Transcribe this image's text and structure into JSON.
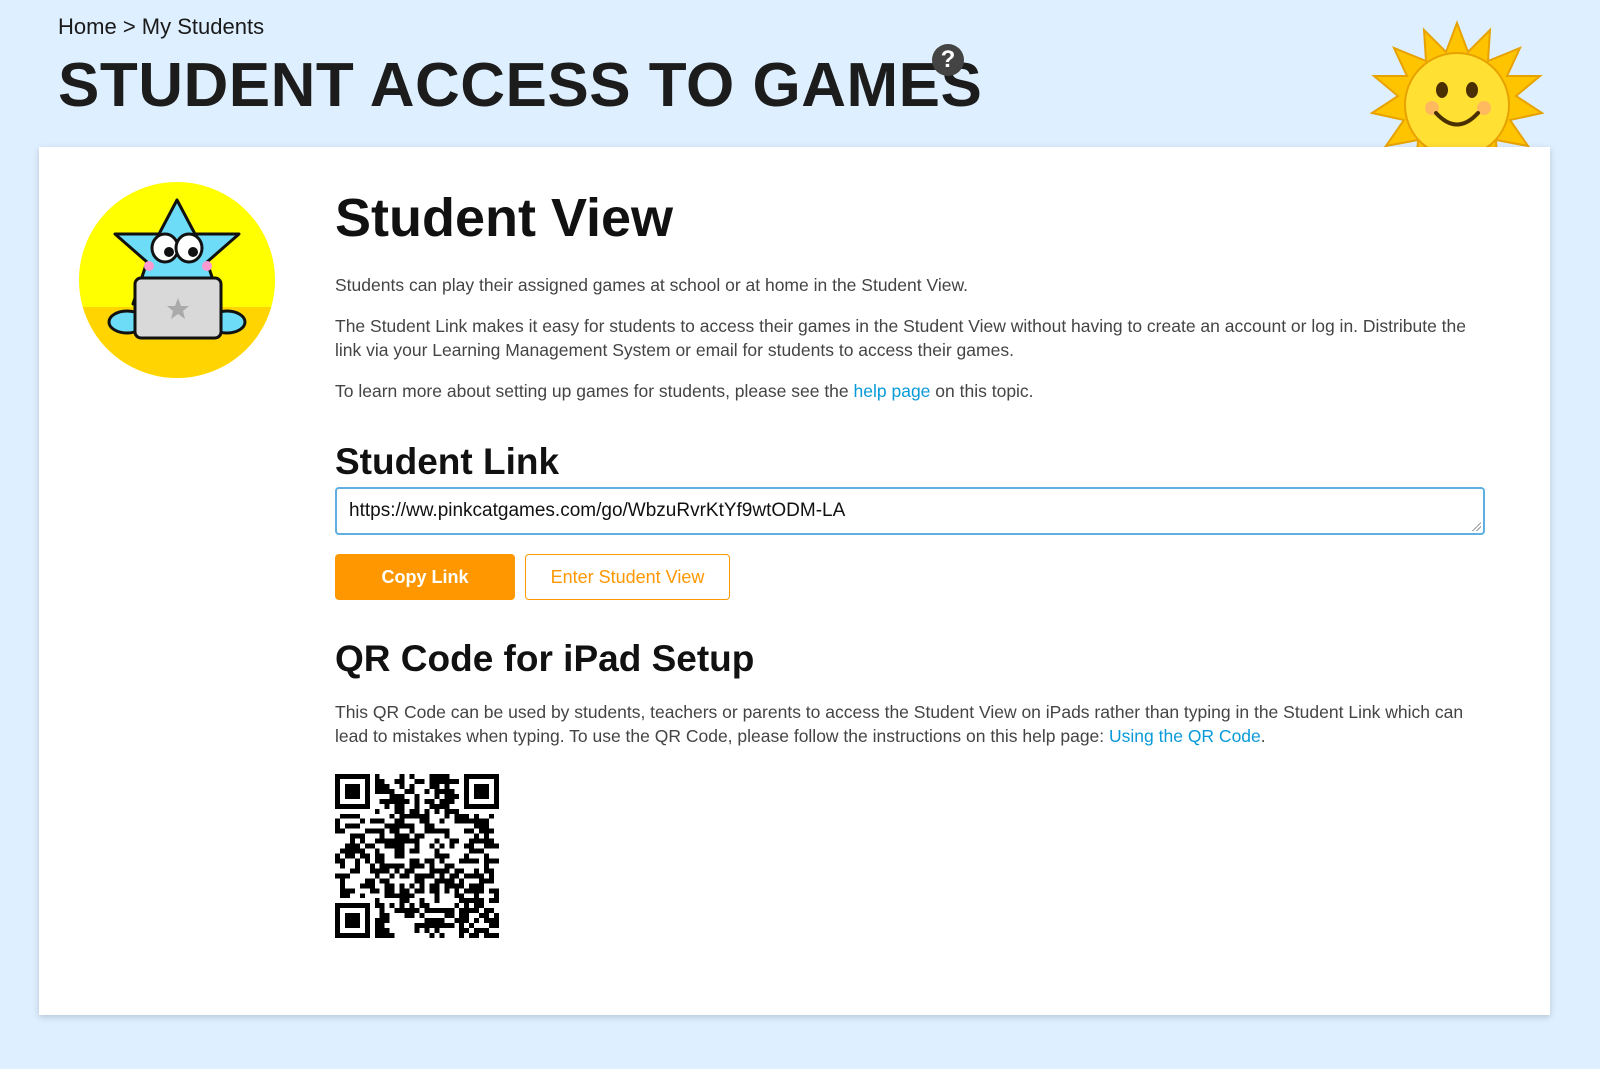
{
  "breadcrumb": {
    "home": "Home",
    "separator": ">",
    "current": "My Students"
  },
  "page": {
    "title": "STUDENT ACCESS TO GAMES",
    "help_icon_glyph": "?"
  },
  "student_view": {
    "title": "Student View",
    "para1": "Students can play their assigned games at school or at home in the Student View.",
    "para2": "The Student Link makes it easy for students to access their games in the Student View without having to create an account or log in. Distribute the link via your Learning Management System or email for students to access their games.",
    "para3_before": "To learn more about setting up games for students, please see the",
    "para3_link": "help page",
    "para3_after": "on this topic."
  },
  "student_link": {
    "title": "Student Link",
    "url": "https://ww.pinkcatgames.com/go/WbzuRvrKtYf9wtODM-LA",
    "copy_label": "Copy Link",
    "enter_label": "Enter Student View"
  },
  "qr_section": {
    "title": "QR Code for iPad Setup",
    "text_before": "This QR Code can be used by students, teachers or parents to access the Student View on iPads rather than typing in the Student Link which can lead to mistakes when typing. To use the QR Code, please follow the instructions on this help page:",
    "link": "Using the QR Code",
    "text_after": "."
  },
  "colors": {
    "background": "#deefff",
    "accent_orange": "#ff9800",
    "link_blue": "#0a9ad8",
    "input_border": "#5fb0e0"
  },
  "icons": [
    "help-icon",
    "sun-mascot",
    "star-mascot-icon",
    "qr-code"
  ]
}
